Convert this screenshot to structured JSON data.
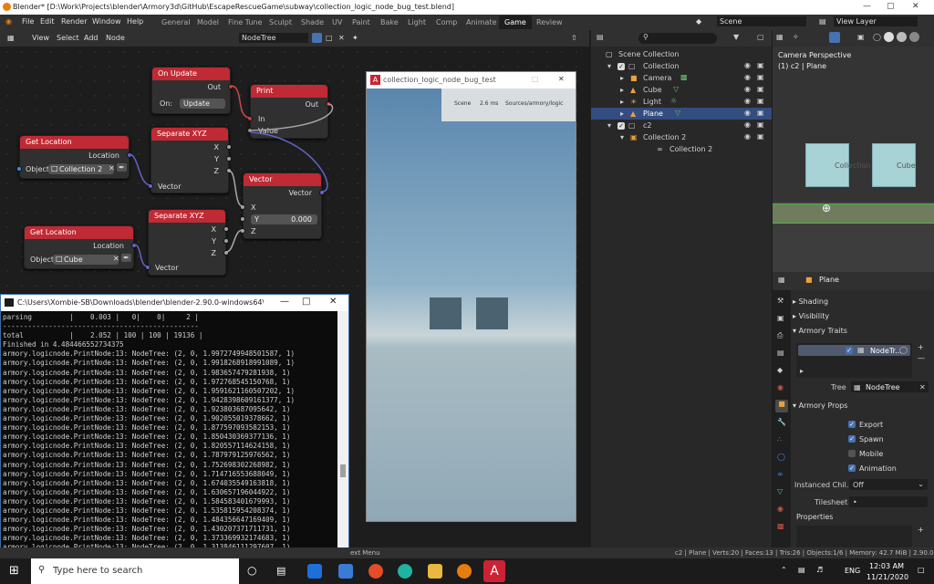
{
  "titlebar": {
    "title": "Blender* [D:\\Work\\Projects\\blender\\Armory3d\\GitHub\\EscapeRescueGame\\subway\\collection_logic_node_bug_test.blend]"
  },
  "menubar": {
    "menus": [
      "File",
      "Edit",
      "Render",
      "Window",
      "Help"
    ],
    "workspaces": [
      "General",
      "Model",
      "Fine Tune",
      "Sculpt",
      "Shade",
      "UV",
      "Paint",
      "Bake",
      "Light",
      "Comp",
      "Animate",
      "Game",
      "Review"
    ],
    "active_workspace": "Game",
    "scene": "Scene",
    "view_layer": "View Layer"
  },
  "node_editor": {
    "header_menus": [
      "View",
      "Select",
      "Add",
      "Node"
    ],
    "tree_name": "NodeTree",
    "nodes": {
      "on_update": {
        "title": "On Update",
        "out": "Out",
        "on_label": "On:",
        "on_value": "Update"
      },
      "print": {
        "title": "Print",
        "out": "Out",
        "in": "In",
        "value": "Value"
      },
      "get_location_1": {
        "title": "Get Location",
        "location": "Location",
        "object_label": "Object",
        "object_value": "Collection 2"
      },
      "separate_xyz_1": {
        "title": "Separate XYZ",
        "x": "X",
        "y": "Y",
        "z": "Z",
        "vector": "Vector"
      },
      "vector": {
        "title": "Vector",
        "vector": "Vector",
        "x": "X",
        "y_label": "Y",
        "y_value": "0.000",
        "z": "Z"
      },
      "get_location_2": {
        "title": "Get Location",
        "location": "Location",
        "object_label": "Object",
        "object_value": "Cube"
      },
      "separate_xyz_2": {
        "title": "Separate XYZ",
        "x": "X",
        "y": "Y",
        "z": "Z",
        "vector": "Vector"
      }
    }
  },
  "game_window": {
    "title": "collection_logic_node_bug_test",
    "stats": [
      "Scene",
      "2.6 ms",
      "Sources/armory/logic"
    ]
  },
  "console": {
    "title": "C:\\Users\\Xombie-SB\\Downloads\\blender\\blender-2.90.0-windows64\\blen...",
    "lines": [
      "parsing         |    0.003 |   0|    0|     2 |",
      "-----------------------------------------------",
      "total           |    2.052 | 100 | 100 | 19136 |",
      "Finished in 4.484466552734375",
      "armory.logicnode.PrintNode:13: NodeTree: (2, 0, 1.9972749948501587, 1)",
      "armory.logicnode.PrintNode:13: NodeTree: (2, 0, 1.9918268918991089, 1)",
      "armory.logicnode.PrintNode:13: NodeTree: (2, 0, 1.983657479281938, 1)",
      "armory.logicnode.PrintNode:13: NodeTree: (2, 0, 1.972768545150768, 1)",
      "armory.logicnode.PrintNode:13: NodeTree: (2, 0, 1.9591621160507202, 1)",
      "armory.logicnode.PrintNode:13: NodeTree: (2, 0, 1.9428398609161377, 1)",
      "armory.logicnode.PrintNode:13: NodeTree: (2, 0, 1.923803687095642, 1)",
      "armory.logicnode.PrintNode:13: NodeTree: (2, 0, 1.902055019378662, 1)",
      "armory.logicnode.PrintNode:13: NodeTree: (2, 0, 1.877597093582153, 1)",
      "armory.logicnode.PrintNode:13: NodeTree: (2, 0, 1.850430369377136, 1)",
      "armory.logicnode.PrintNode:13: NodeTree: (2, 0, 1.820557114624158, 1)",
      "armory.logicnode.PrintNode:13: NodeTree: (2, 0, 1.787979125976562, 1)",
      "armory.logicnode.PrintNode:13: NodeTree: (2, 0, 1.752698302268982, 1)",
      "armory.logicnode.PrintNode:13: NodeTree: (2, 0, 1.714716553688049, 1)",
      "armory.logicnode.PrintNode:13: NodeTree: (2, 0, 1.674035549163818, 1)",
      "armory.logicnode.PrintNode:13: NodeTree: (2, 0, 1.630657196044922, 1)",
      "armory.logicnode.PrintNode:13: NodeTree: (2, 0, 1.584583401679993, 1)",
      "armory.logicnode.PrintNode:13: NodeTree: (2, 0, 1.535815954208374, 1)",
      "armory.logicnode.PrintNode:13: NodeTree: (2, 0, 1.484356647169409, 1)",
      "armory.logicnode.PrintNode:13: NodeTree: (2, 0, 1.430207371711731, 1)",
      "armory.logicnode.PrintNode:13: NodeTree: (2, 0, 1.373369932174683, 1)",
      "armory.logicnode.PrintNode:13: NodeTree: (2, 0, 1.313846111297607, 1)"
    ]
  },
  "outliner": {
    "root": "Scene Collection",
    "rows": [
      "Collection",
      "Camera",
      "Cube",
      "Light",
      "Plane",
      "c2",
      "Collection 2",
      "Collection 2"
    ],
    "selected": "Plane"
  },
  "viewport": {
    "title": "Camera Perspective",
    "subtitle": "(1) c2 | Plane",
    "labels": [
      "Collection 2",
      "Cube"
    ]
  },
  "properties": {
    "object_name": "Plane",
    "sections": [
      "Shading",
      "Visibility",
      "Armory Traits",
      "Armory Props"
    ],
    "trait_name": "NodeTr...",
    "tree_label": "Tree",
    "tree_value": "NodeTree",
    "checkboxes": [
      {
        "label": "Export",
        "checked": true
      },
      {
        "label": "Spawn",
        "checked": true
      },
      {
        "label": "Mobile",
        "checked": false
      },
      {
        "label": "Animation",
        "checked": true
      }
    ],
    "instanced_label": "Instanced Chil...",
    "instanced_value": "Off",
    "tilesheet_label": "Tilesheet",
    "tilesheet_value": "•",
    "properties_label": "Properties"
  },
  "statusbar": {
    "left": "ext Menu",
    "right": "c2 | Plane | Verts:20 | Faces:13 | Tris:26 | Objects:1/6 | Memory: 42.7 MiB | 2.90.0"
  },
  "taskbar": {
    "search": "Type here to search",
    "time": "12:03 AM",
    "date": "11/21/2020",
    "lang": "ENG"
  },
  "colors": {
    "node_header": "#bf2a34",
    "selection": "#334d80",
    "accent": "#4772b3"
  }
}
